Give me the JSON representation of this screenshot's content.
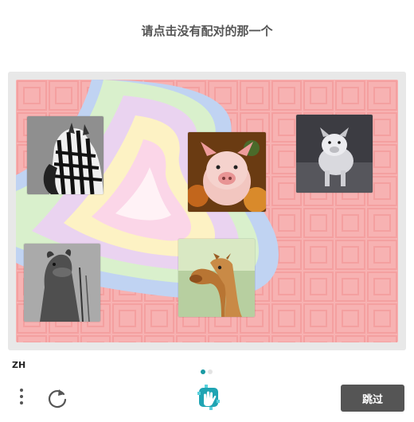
{
  "prompt": "请点击没有配对的那一个",
  "footer": {
    "language": "ZH",
    "skip_label": "跳过",
    "page_indicator": {
      "current": 1,
      "total": 2
    }
  },
  "tiles": [
    {
      "id": "zebra",
      "animal": "zebra"
    },
    {
      "id": "pig-autumn",
      "animal": "pig"
    },
    {
      "id": "pig-grey",
      "animal": "pig"
    },
    {
      "id": "camel-mono",
      "animal": "camel"
    },
    {
      "id": "camel-color",
      "animal": "camel"
    }
  ],
  "icons": {
    "menu": "vertical-dots-icon",
    "refresh": "refresh-icon",
    "logo": "hand-logo-icon"
  },
  "colors": {
    "accent": "#1a9aa3",
    "skip_button": "#555555",
    "board_bg": "#f7b2b2"
  }
}
